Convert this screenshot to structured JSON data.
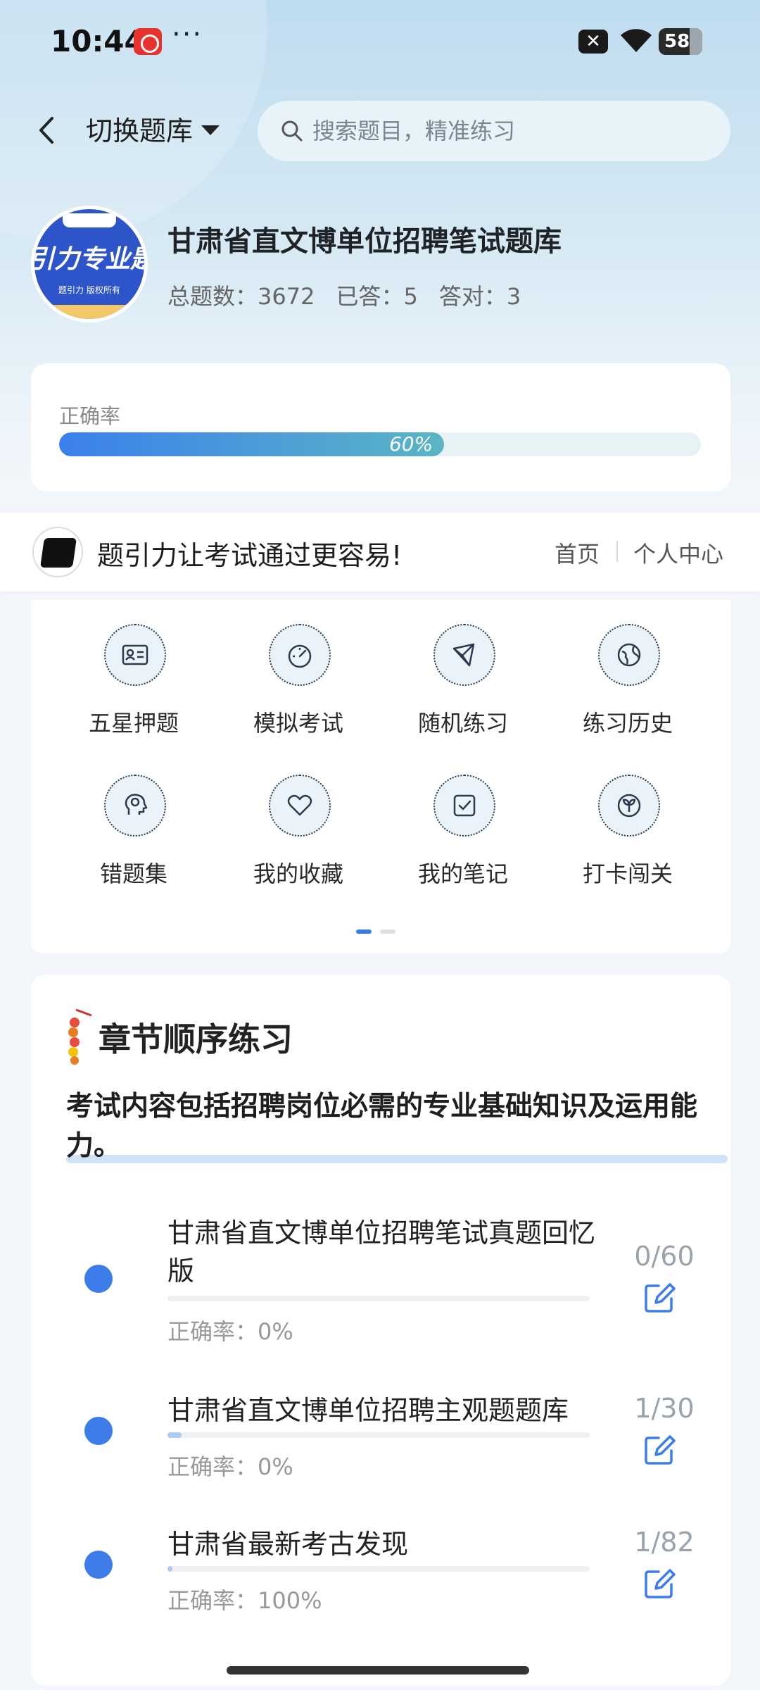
{
  "status_bar": {
    "time": "10:44",
    "dots": "···",
    "battery": "58",
    "x_badge": "✕"
  },
  "header": {
    "switch_bank_label": "切换题库",
    "search_placeholder": "搜索题目，精准练习"
  },
  "bank": {
    "logo_text": "引力专业题",
    "logo_sub": "题引力 版权所有",
    "title": "甘肃省直文博单位招聘笔试题库",
    "stats": {
      "total_label": "总题数：3672",
      "answered_label": "已答：5",
      "correct_label": "答对：3"
    }
  },
  "accuracy": {
    "label": "正确率",
    "value_text": "60%",
    "value": 0.6
  },
  "promo": {
    "text": "题引力让考试通过更容易!",
    "home": "首页",
    "personal_center": "个人中心"
  },
  "menu": {
    "items": [
      {
        "label": "五星押题",
        "icon": "id-card-icon"
      },
      {
        "label": "模拟考试",
        "icon": "speedometer-icon"
      },
      {
        "label": "随机练习",
        "icon": "shuffle-shape-icon"
      },
      {
        "label": "练习历史",
        "icon": "globe-icon"
      },
      {
        "label": "错题集",
        "icon": "head-icon"
      },
      {
        "label": "我的收藏",
        "icon": "heart-icon"
      },
      {
        "label": "我的笔记",
        "icon": "note-check-icon"
      },
      {
        "label": "打卡闯关",
        "icon": "sprout-icon"
      }
    ],
    "page_count": 2,
    "active_page": 0
  },
  "chapter": {
    "title": "章节顺序练习",
    "description": "考试内容包括招聘岗位必需的专业基础知识及运用能力。",
    "items": [
      {
        "name": "甘肃省直文博单位招聘笔试真题回忆版",
        "accuracy": "正确率：0%",
        "count": "0/60",
        "progress": 0.0
      },
      {
        "name": "甘肃省直文博单位招聘主观题题库",
        "accuracy": "正确率：0%",
        "count": "1/30",
        "progress": 0.033
      },
      {
        "name": "甘肃省最新考古发现",
        "accuracy": "正确率：100%",
        "count": "1/82",
        "progress": 0.012
      }
    ]
  },
  "colors": {
    "accent": "#3c7de9",
    "progress_start": "#3b80ec",
    "progress_end": "#5bb5c5"
  }
}
